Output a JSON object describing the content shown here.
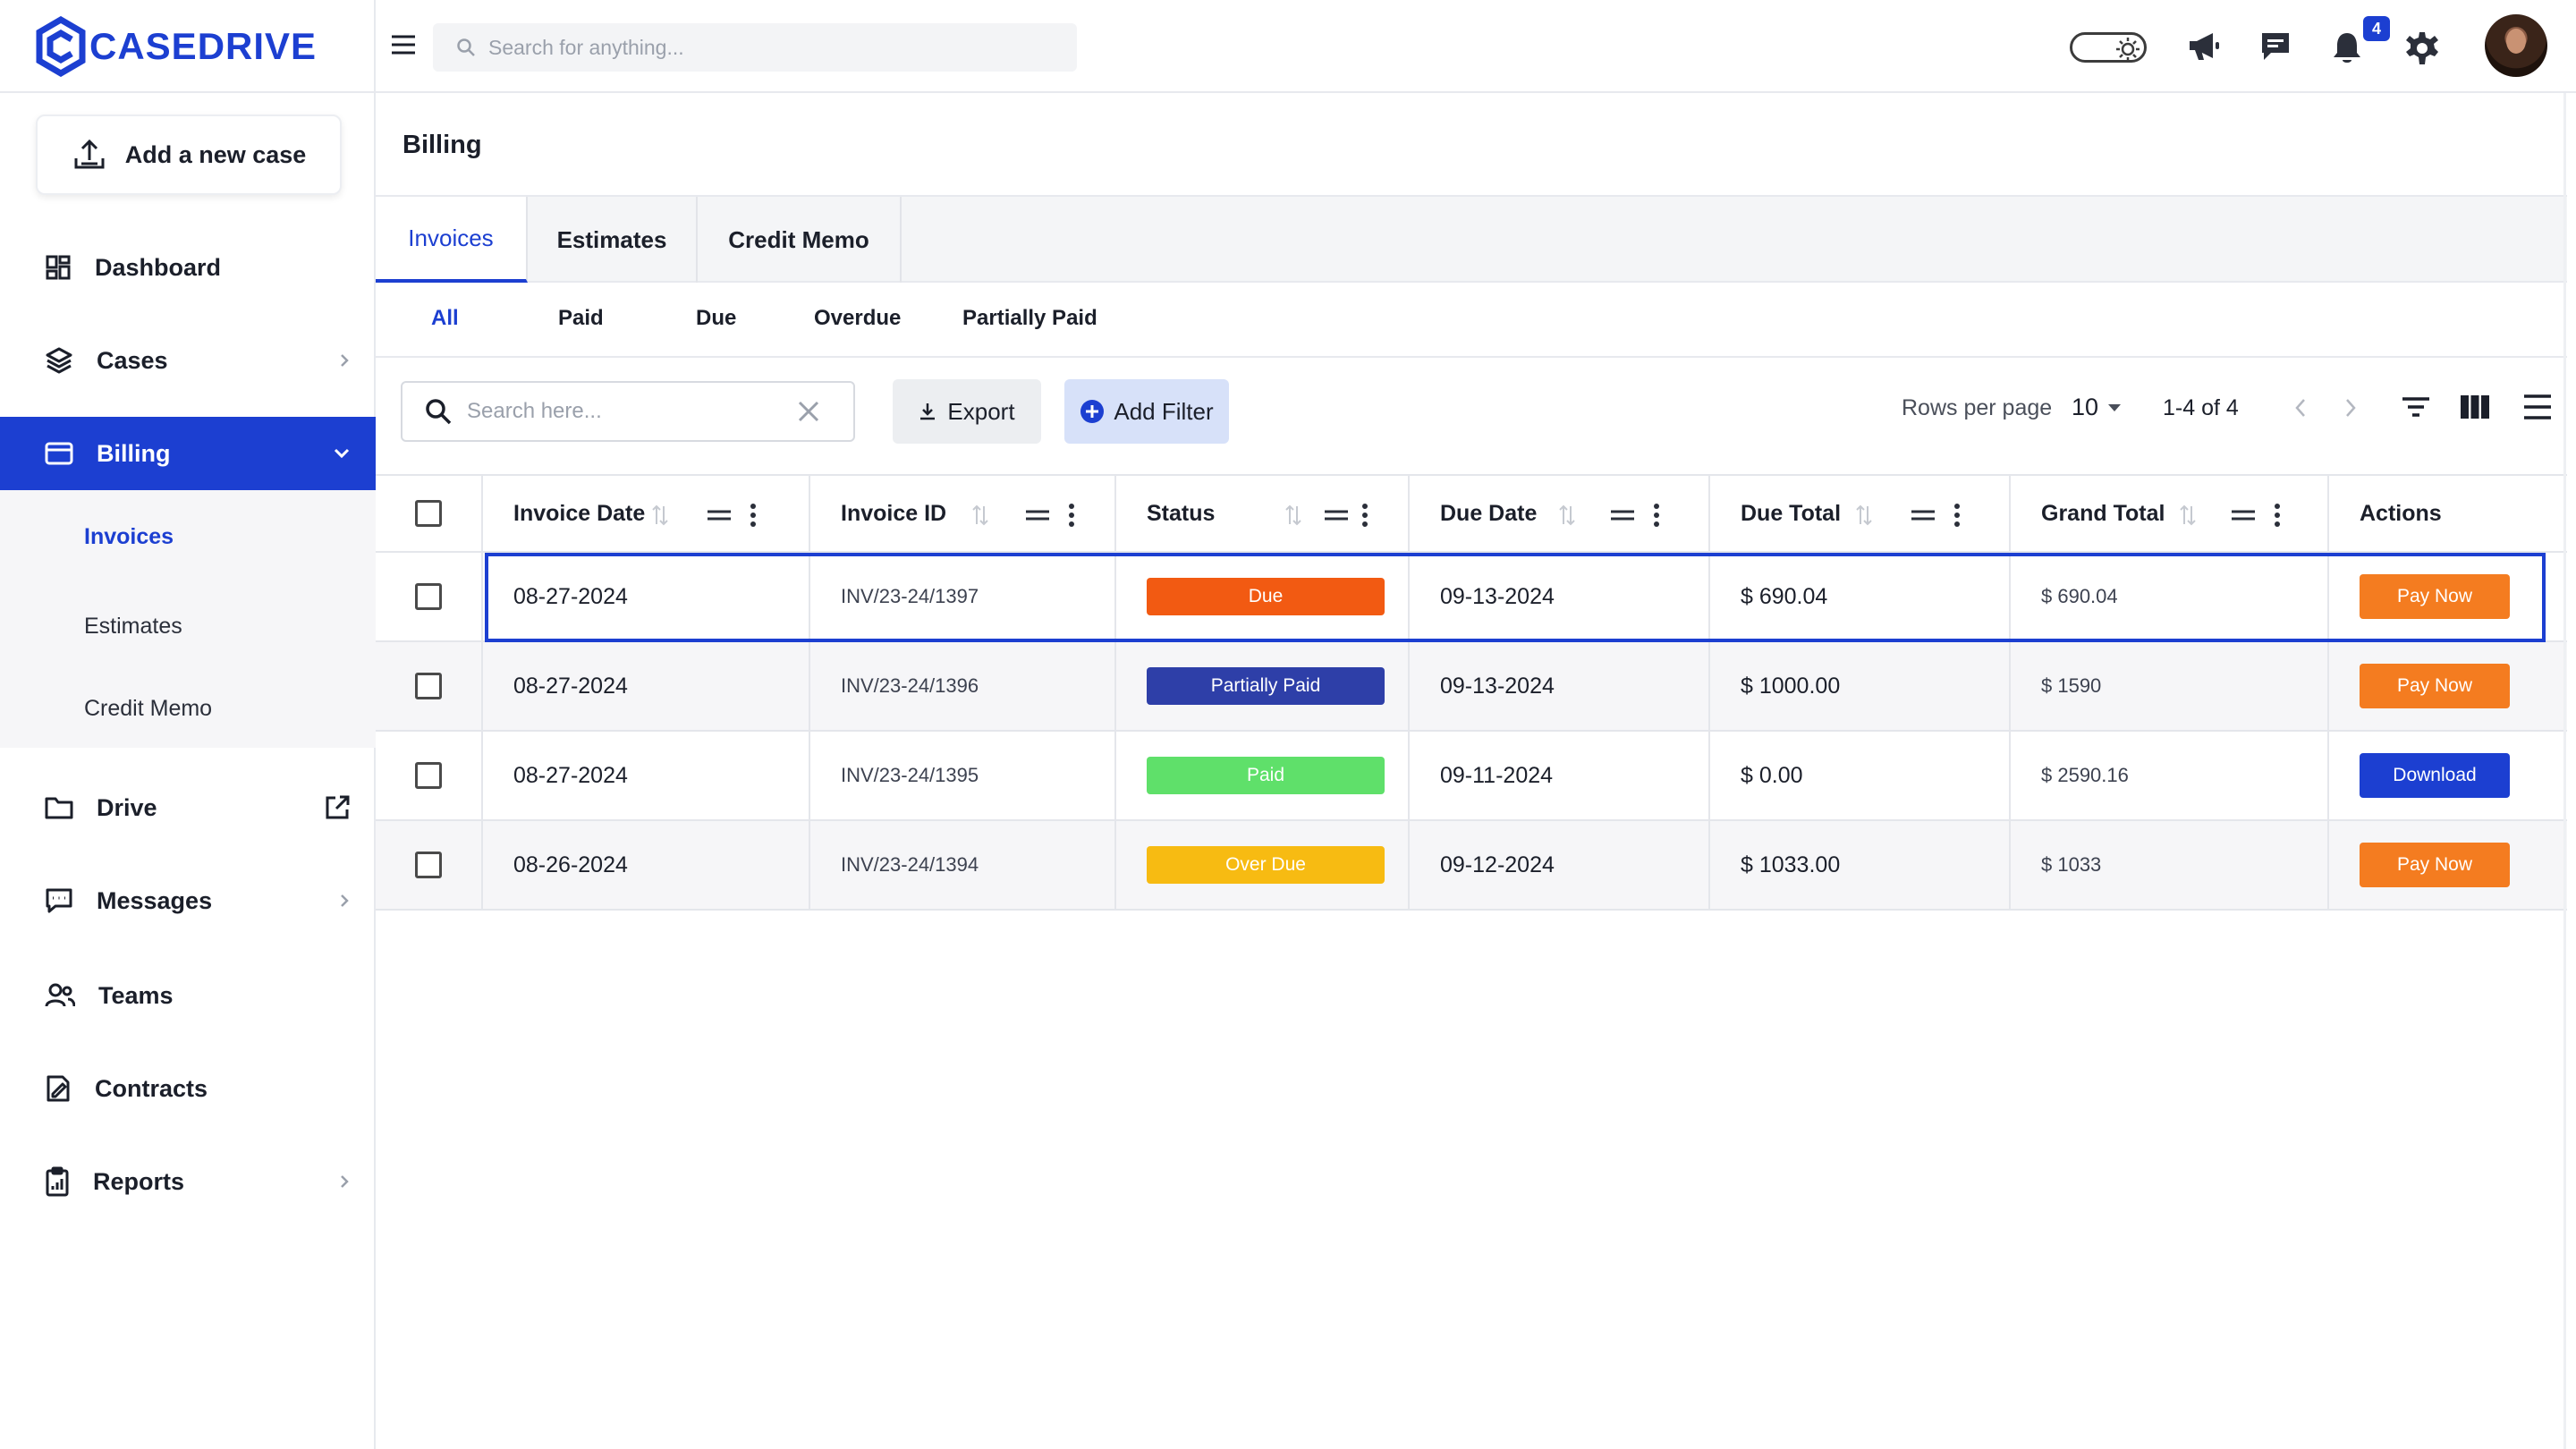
{
  "brand": {
    "name": "CASEDRIVE",
    "color": "#1c3fd1"
  },
  "sidebar": {
    "add_case_label": "Add a new case",
    "items": [
      {
        "label": "Dashboard",
        "icon": "dashboard-icon"
      },
      {
        "label": "Cases",
        "icon": "layers-icon"
      },
      {
        "label": "Billing",
        "icon": "card-icon"
      },
      {
        "label": "Drive",
        "icon": "folder-icon"
      },
      {
        "label": "Messages",
        "icon": "message-icon"
      },
      {
        "label": "Teams",
        "icon": "teams-icon"
      },
      {
        "label": "Contracts",
        "icon": "contract-icon"
      },
      {
        "label": "Reports",
        "icon": "clipboard-icon"
      }
    ],
    "billing_sub": [
      "Invoices",
      "Estimates",
      "Credit Memo"
    ]
  },
  "topbar": {
    "search_placeholder": "Search for anything...",
    "notification_count": "4"
  },
  "page": {
    "title": "Billing"
  },
  "tabs": [
    "Invoices",
    "Estimates",
    "Credit Memo"
  ],
  "subtabs": [
    "All",
    "Paid",
    "Due",
    "Overdue",
    "Partially Paid"
  ],
  "toolbar": {
    "search_placeholder": "Search here...",
    "export_label": "Export",
    "add_filter_label": "Add Filter",
    "rows_per_page_label": "Rows per page",
    "rows_per_page_value": "10",
    "range": "1-4 of 4"
  },
  "table": {
    "columns": [
      "Invoice Date",
      "Invoice ID",
      "Status",
      "Due Date",
      "Due Total",
      "Grand Total",
      "Actions"
    ],
    "rows": [
      {
        "invoice_date": "08-27-2024",
        "invoice_id": "INV/23-24/1397",
        "status": "Due",
        "status_color": "#f25a12",
        "due_date": "09-13-2024",
        "due_total": "$ 690.04",
        "grand_total": "$ 690.04",
        "action": "Pay Now",
        "action_color": "#f47c20"
      },
      {
        "invoice_date": "08-27-2024",
        "invoice_id": "INV/23-24/1396",
        "status": "Partially Paid",
        "status_color": "#2e3fa8",
        "due_date": "09-13-2024",
        "due_total": "$ 1000.00",
        "grand_total": "$ 1590",
        "action": "Pay Now",
        "action_color": "#f47c20"
      },
      {
        "invoice_date": "08-27-2024",
        "invoice_id": "INV/23-24/1395",
        "status": "Paid",
        "status_color": "#5fe06a",
        "due_date": "09-11-2024",
        "due_total": "$ 0.00",
        "grand_total": "$ 2590.16",
        "action": "Download",
        "action_color": "#1c3fd1"
      },
      {
        "invoice_date": "08-26-2024",
        "invoice_id": "INV/23-24/1394",
        "status": "Over Due",
        "status_color": "#f7bb12",
        "due_date": "09-12-2024",
        "due_total": "$ 1033.00",
        "grand_total": "$ 1033",
        "action": "Pay Now",
        "action_color": "#f47c20"
      }
    ]
  }
}
